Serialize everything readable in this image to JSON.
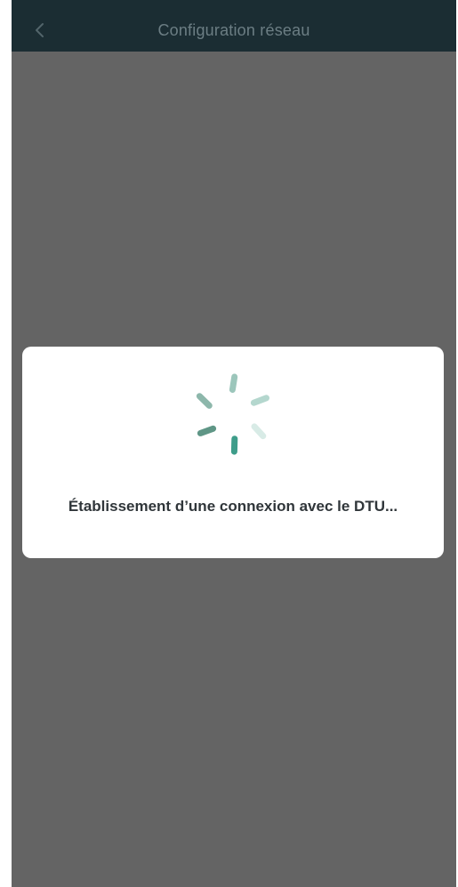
{
  "app_bar": {
    "title": "Configuration réseau",
    "back_icon": "chevron-left-icon"
  },
  "loading_dialog": {
    "spinner_icon": "loading-spinner-icon",
    "message": "Établissement d’une connexion avec le DTU..."
  },
  "colors": {
    "app_bar_background": "#1b2d33",
    "title_text": "#6c7e84",
    "overlay": "#646464",
    "dialog_background": "#ffffff",
    "message_text": "#30363a",
    "spinner_accent": "#3e9d8a"
  }
}
